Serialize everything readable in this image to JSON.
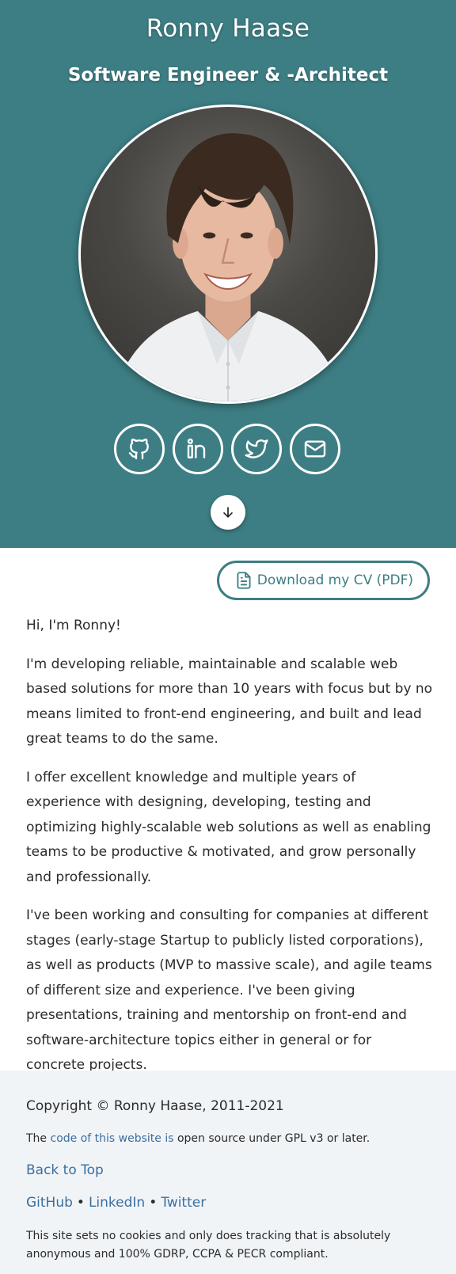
{
  "hero": {
    "name": "Ronny Haase",
    "role": "Software Engineer & -Architect",
    "background_color": "#3d7e84",
    "portrait_icon": "portrait-photo",
    "social": [
      {
        "name": "github",
        "icon": "github-icon"
      },
      {
        "name": "linkedin",
        "icon": "linkedin-icon"
      },
      {
        "name": "twitter",
        "icon": "twitter-icon"
      },
      {
        "name": "email",
        "icon": "mail-icon"
      }
    ],
    "scroll_icon": "arrow-down-icon"
  },
  "cv": {
    "label": "Download my CV (PDF)",
    "icon": "document-icon",
    "accent_color": "#3d7e84"
  },
  "content": {
    "greeting": "Hi, I'm Ronny!",
    "paragraphs": [
      "I'm developing reliable, maintainable and scalable web based solutions for more than 10 years with focus but by no means limited to front-end engineering, and built and lead great teams to do the same.",
      "I offer excellent knowledge and multiple years of experience with designing, developing, testing and optimizing highly-scalable web solutions as well as enabling teams to be productive & motivated, and grow personally and professionally.",
      "I've been working and consulting for companies at different stages (early-stage Startup to publicly listed corporations), as well as products (MVP to massive scale), and agile teams of different size and experience. I've been giving presentations, training and mentorship on front-end and software-architecture topics either in general or for concrete projects."
    ]
  },
  "footer": {
    "copyright": "Copyright © Ronny Haase, 2011-2021",
    "code_prefix": "The ",
    "code_link": "code of this website is",
    "code_suffix": " open source under GPL v3 or later.",
    "back_to_top": "Back to Top",
    "socials": [
      "GitHub",
      "LinkedIn",
      "Twitter"
    ],
    "separator": "•",
    "privacy": "This site sets no cookies and only does tracking that is absolutely anonymous and 100% GDRP, CCPA & PECR compliant.",
    "link_color": "#3a6f9e",
    "background_color": "#f1f4f7"
  }
}
